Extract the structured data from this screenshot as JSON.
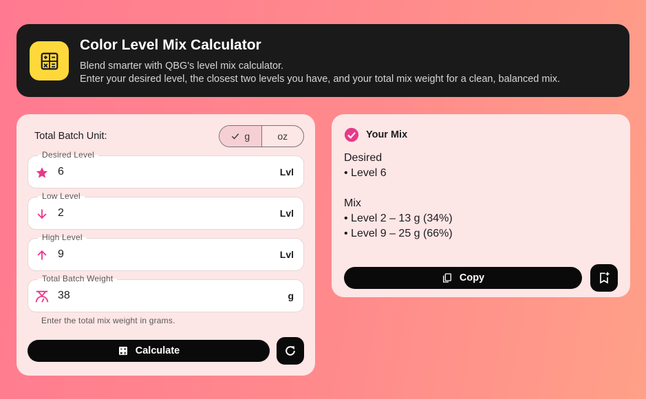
{
  "header": {
    "title": "Color Level Mix Calculator",
    "subtitle_line1": "Blend smarter with QBG's level mix calculator.",
    "subtitle_line2": "Enter your desired level, the closest two levels you have, and your total mix weight for a clean, balanced mix.",
    "icon": "calculator-icon"
  },
  "form": {
    "unit_label": "Total Batch Unit:",
    "unit_options": [
      "g",
      "oz"
    ],
    "unit_selected": "g",
    "fields": [
      {
        "label": "Desired Level",
        "value": "6",
        "suffix": "Lvl",
        "icon": "star-icon"
      },
      {
        "label": "Low Level",
        "value": "2",
        "suffix": "Lvl",
        "icon": "arrow-down-icon"
      },
      {
        "label": "High Level",
        "value": "9",
        "suffix": "Lvl",
        "icon": "arrow-up-icon"
      },
      {
        "label": "Total Batch Weight",
        "value": "38",
        "suffix": "g",
        "icon": "scale-icon"
      }
    ],
    "helper": "Enter the total mix weight in grams.",
    "calculate_label": "Calculate"
  },
  "result": {
    "title": "Your Mix",
    "desired_heading": "Desired",
    "desired_line": "• Level 6",
    "mix_heading": "Mix",
    "mix_lines": [
      "• Level 2 – 13 g (34%)",
      "• Level 9 – 25 g (66%)"
    ],
    "copy_label": "Copy"
  },
  "colors": {
    "accent": "#e8388a",
    "header_bg": "#1a1a1a",
    "icon_yellow": "#ffd93b",
    "card_bg": "#fde6e6",
    "button_bg": "#0a0a0a"
  }
}
